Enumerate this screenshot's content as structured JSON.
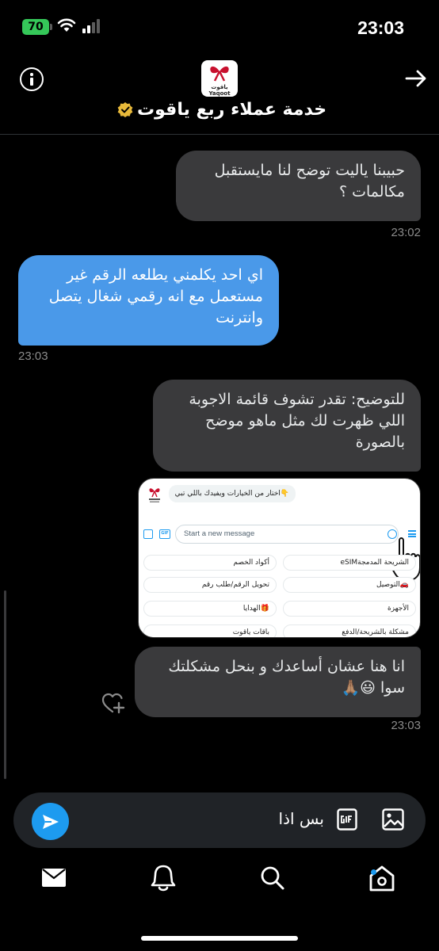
{
  "status_bar": {
    "battery": "70",
    "time": "23:03"
  },
  "header": {
    "logo_text_ar": "ياقوت",
    "logo_text_en": "Yaqoot",
    "title": "خدمة عملاء ربع ياقوت"
  },
  "messages": [
    {
      "direction": "out",
      "text": "حبيبنا ياليت توضح لنا مايستقبل مكالمات ؟",
      "time": "23:02"
    },
    {
      "direction": "in",
      "text": "اي احد يكلمني يطلعه الرقم غير مستعمل مع انه رقمي شغال يتصل وانترنت",
      "time": "23:03"
    },
    {
      "direction": "out",
      "text": "للتوضيح: تقدر تشوف قائمة الاجوبة اللي ظهرت لك مثل ماهو موضح بالصورة"
    },
    {
      "direction": "out",
      "text": "انا هنا عشان أساعدك و بنحل مشكلتك سوا 😃🙏🏽",
      "time": "23:03"
    }
  ],
  "attachment": {
    "prompt": "👇اختار من الخيارات ويفيدك باللي تبي",
    "input_placeholder": "Start a new message",
    "options": [
      "الشريحة المدمجةeSIM",
      "أكواد الخصم",
      "🚗التوصيل",
      "تحويل الرقم/طلب رقم",
      "الأجهزة",
      "🎁الهدايا",
      "مشكلة بالشريحة/الدفع",
      "باقات ياقوت"
    ]
  },
  "composer": {
    "text": "بس اذا"
  },
  "icons": {
    "info": "info-icon",
    "back": "arrow-right-icon",
    "verified": "verified-badge-icon",
    "react": "heart-plus-icon",
    "send": "send-icon",
    "gif": "gif-icon",
    "image": "image-icon",
    "tabs": [
      "messages-icon",
      "notifications-icon",
      "search-icon",
      "home-icon"
    ]
  },
  "colors": {
    "accent": "#1d9bf0",
    "incoming_bubble": "#4a99e9",
    "outgoing_bubble": "#3a3a3c",
    "verified": "#e8b93a"
  }
}
